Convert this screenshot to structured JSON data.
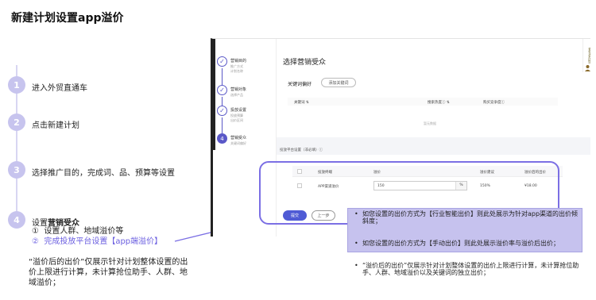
{
  "page": {
    "title": "新建计划设置app溢价"
  },
  "steps": [
    {
      "num": "1",
      "text": "进入外贸直通车"
    },
    {
      "num": "2",
      "text": "点击新建计划"
    },
    {
      "num": "3",
      "text": "选择推广目的，完成词、品、预算等设置"
    },
    {
      "num": "4",
      "text_prefix": "设置",
      "text_bold": "营销受众"
    }
  ],
  "substeps": [
    {
      "num": "①",
      "text": "设置人群、地域溢价等"
    },
    {
      "num": "②",
      "text": "完成投放平台设置【app端溢价】"
    }
  ],
  "note": "“溢价后的出价”仅展示针对计划整体设置的出价上限进行计算，未计算抢位助手、人群、地域溢价；",
  "screenshot": {
    "nav": [
      {
        "title": "营销目的",
        "subs": [
          "推广方式",
          "计划名称"
        ],
        "state": "done"
      },
      {
        "title": "营销对象",
        "subs": [
          "选择产品"
        ],
        "state": "done"
      },
      {
        "title": "投放设置",
        "subs": [
          "投放预算",
          "出价区间"
        ],
        "state": "done"
      },
      {
        "title": "营销受众",
        "subs": [
          "关键词偏好"
        ],
        "state": "active",
        "num": "4"
      }
    ],
    "heading": "选择营销受众",
    "keyword": {
      "label": "关键词偏好",
      "add_button": "添加关键词",
      "columns": [
        "关键词 ⇅",
        "搜索热度ⓘ ⇅",
        "购买竞争度ⓘ"
      ],
      "empty_text": "暂无数据"
    },
    "platform": {
      "label": "投放平台设置（非必填）ⓘ",
      "columns": [
        "投放终端",
        "溢价",
        "溢价建议",
        "溢价后的出价"
      ],
      "row": {
        "terminal": "APP渠道溢价",
        "premium": "150",
        "unit": "%",
        "suggest": "150%",
        "price": "¥18.00"
      }
    },
    "submit_button": "提交",
    "prev_button": "上一步",
    "side_text": "意见反馈"
  },
  "callout": {
    "bullets": [
      "如您设置的出价方式为【行业智能出价】则此处展示为针对app渠道的出价倾斜度；",
      "如您设置的出价方式为【手动出价】则此处展示溢价率与溢价后出价；",
      "“溢价后的出价”仅展示针对计划整体设置的出价上限进行计算，未计算抢位助手、人群、地域溢价以及关键词的独立出价；"
    ]
  },
  "colors": {
    "accent": "#7b6fe4",
    "step_circle": "#c7c4ee",
    "callout_bg": "#c6c2ee",
    "primary_button": "#4f5bd5"
  }
}
